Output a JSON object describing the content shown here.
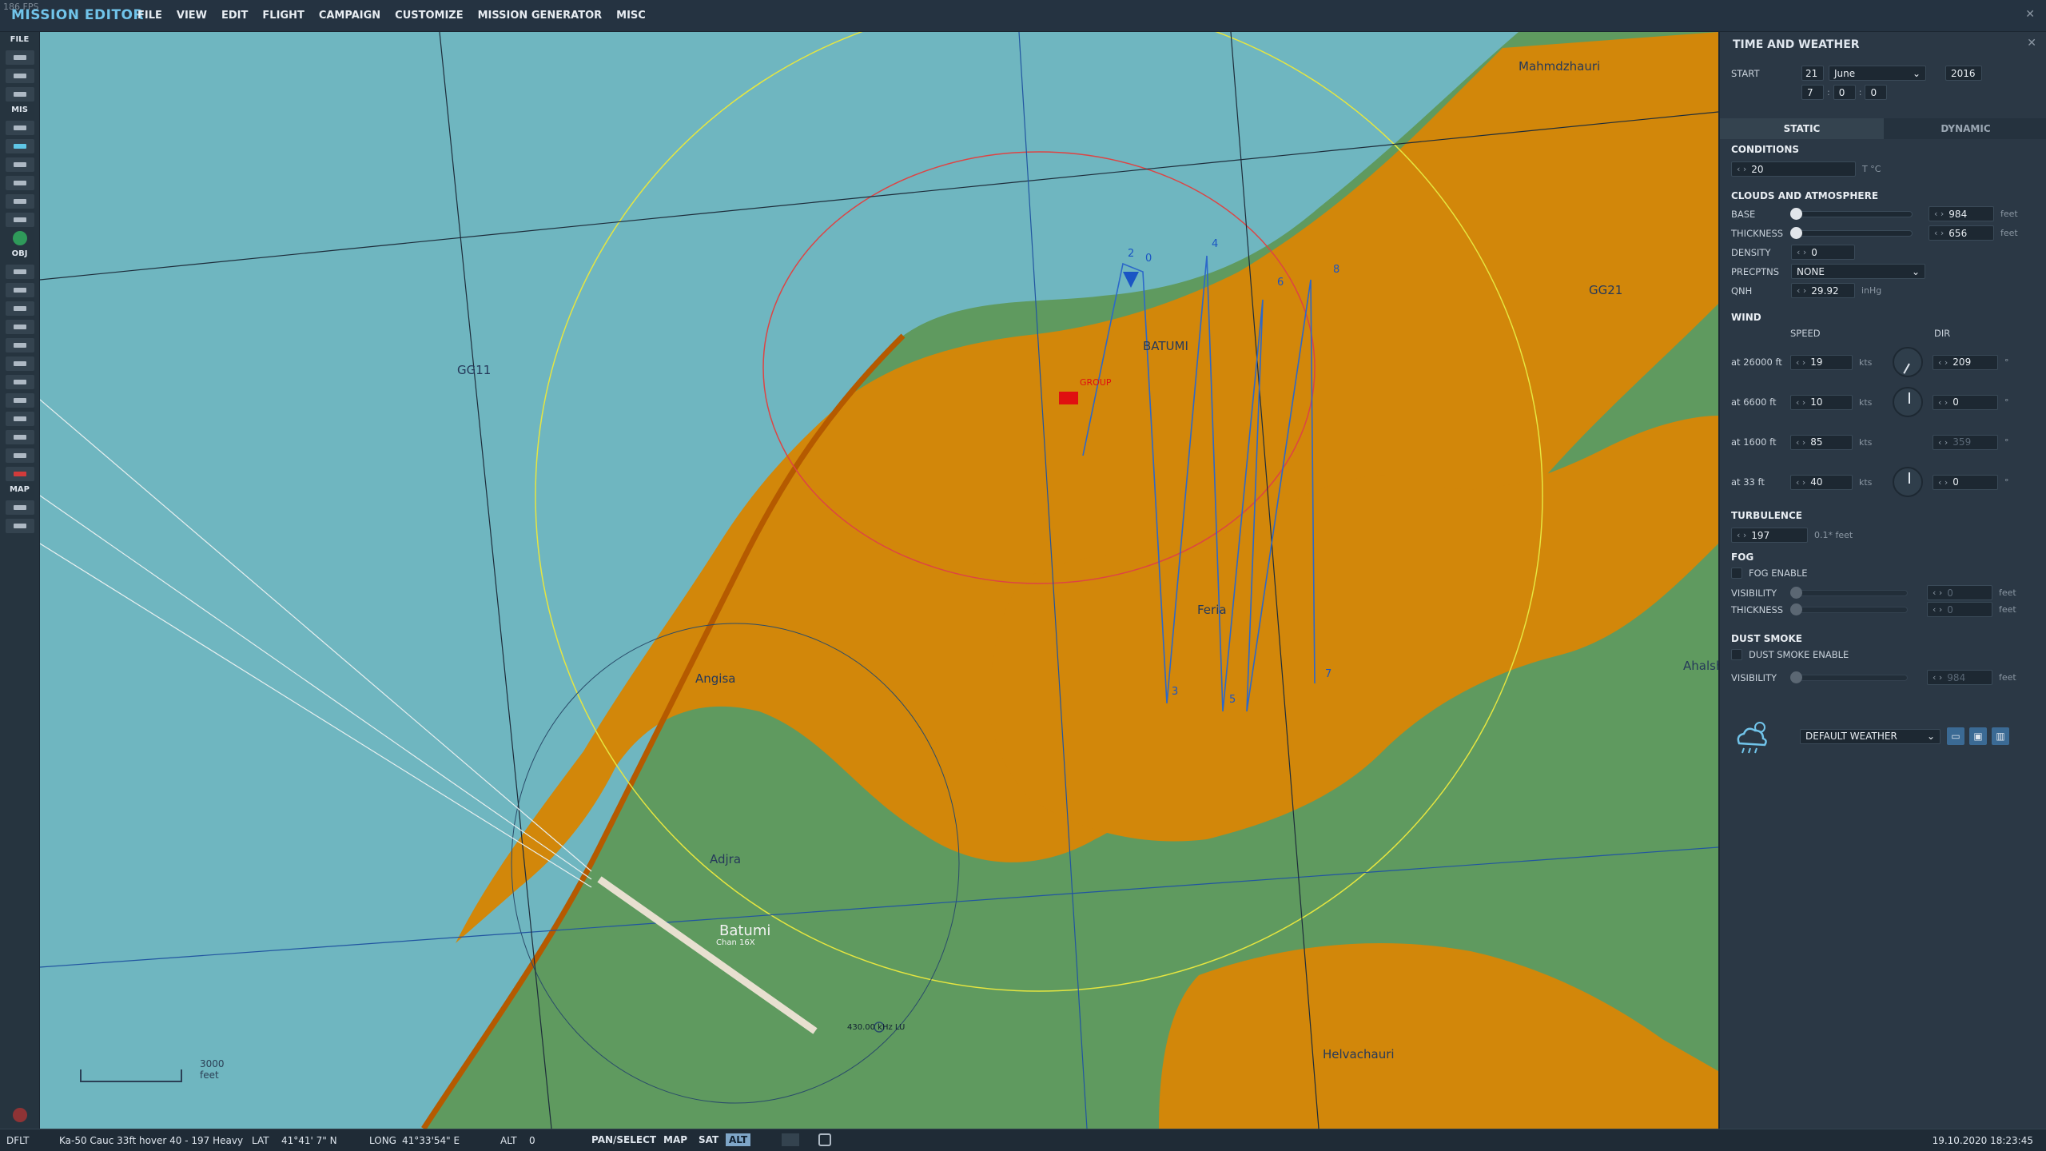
{
  "app": {
    "fps": "186 FPS",
    "title": "MISSION EDITOR",
    "close": "✕"
  },
  "menu": [
    "FILE",
    "VIEW",
    "EDIT",
    "FLIGHT",
    "CAMPAIGN",
    "CUSTOMIZE",
    "MISSION GENERATOR",
    "MISC"
  ],
  "toolbar": {
    "file": "FILE",
    "mis": "MIS",
    "obj": "OBJ",
    "map": "MAP"
  },
  "map": {
    "labels": {
      "gg11": "GG11",
      "gg21": "GG21",
      "batumi_city": "BATUMI",
      "batumi_ab": "Batumi",
      "chan": "Chan 16X",
      "ndb": "430.00 kHz LU",
      "angisa": "Angisa",
      "adjra": "Adjra",
      "feria": "Feria",
      "helvachauri": "Helvachauri",
      "mahmdzhauri": "Mahmdzhauri",
      "ahalsh": "Ahalsh",
      "group": "GROUP",
      "scale": "3000 feet"
    },
    "waypoints": [
      "0",
      "2",
      "4",
      "6",
      "8",
      "3",
      "5",
      "7"
    ]
  },
  "panel": {
    "title": "TIME AND WEATHER",
    "start": {
      "label": "START",
      "day": "21",
      "month": "June",
      "year": "2016",
      "hour": "7",
      "minute": "0",
      "second": "0"
    },
    "tabs": [
      "STATIC",
      "DYNAMIC"
    ],
    "conditions": {
      "label": "CONDITIONS",
      "temp": "20",
      "temp_unit": "T °C"
    },
    "clouds": {
      "label": "CLOUDS AND ATMOSPHERE",
      "base_label": "BASE",
      "base": "984",
      "thickness_label": "THICKNESS",
      "thickness": "656",
      "unit": "feet",
      "density_label": "DENSITY",
      "density": "0",
      "precip_label": "PRECPTNS",
      "precip": "NONE",
      "qnh_label": "QNH",
      "qnh": "29.92",
      "qnh_unit": "inHg"
    },
    "wind": {
      "label": "WIND",
      "speed_label": "SPEED",
      "dir_label": "DIR",
      "unit": "kts",
      "deg": "°",
      "rows": [
        {
          "alt": "at 26000 ft",
          "speed": "19",
          "dir": "209",
          "angle": 209,
          "dial": true
        },
        {
          "alt": "at 6600 ft",
          "speed": "10",
          "dir": "0",
          "angle": 0,
          "dial": true
        },
        {
          "alt": "at 1600 ft",
          "speed": "85",
          "dir": "359",
          "angle": 359,
          "dial": false
        },
        {
          "alt": "at 33 ft",
          "speed": "40",
          "dir": "0",
          "angle": 0,
          "dial": true
        }
      ]
    },
    "turbulence": {
      "label": "TURBULENCE",
      "value": "197",
      "unit": "0.1* feet"
    },
    "fog": {
      "label": "FOG",
      "enable": "FOG ENABLE",
      "vis_label": "VISIBILITY",
      "vis": "0",
      "thick_label": "THICKNESS",
      "thick": "0",
      "unit": "feet"
    },
    "dust": {
      "label": "DUST SMOKE",
      "enable": "DUST SMOKE ENABLE",
      "vis_label": "VISIBILITY",
      "vis": "984",
      "unit": "feet"
    },
    "preset": "DEFAULT WEATHER"
  },
  "status": {
    "mode": "DFLT",
    "unit": "Ka-50 Cauc 33ft hover 40 - 197 Heavy",
    "lat_label": "LAT",
    "lat": "41°41' 7\" N",
    "long_label": "LONG",
    "long": "41°33'54\" E",
    "alt_label": "ALT",
    "alt": "0",
    "pan": "PAN/SELECT",
    "map": "MAP",
    "sat": "SAT",
    "alt_btn": "ALT",
    "datetime": "19.10.2020 18:23:45"
  }
}
